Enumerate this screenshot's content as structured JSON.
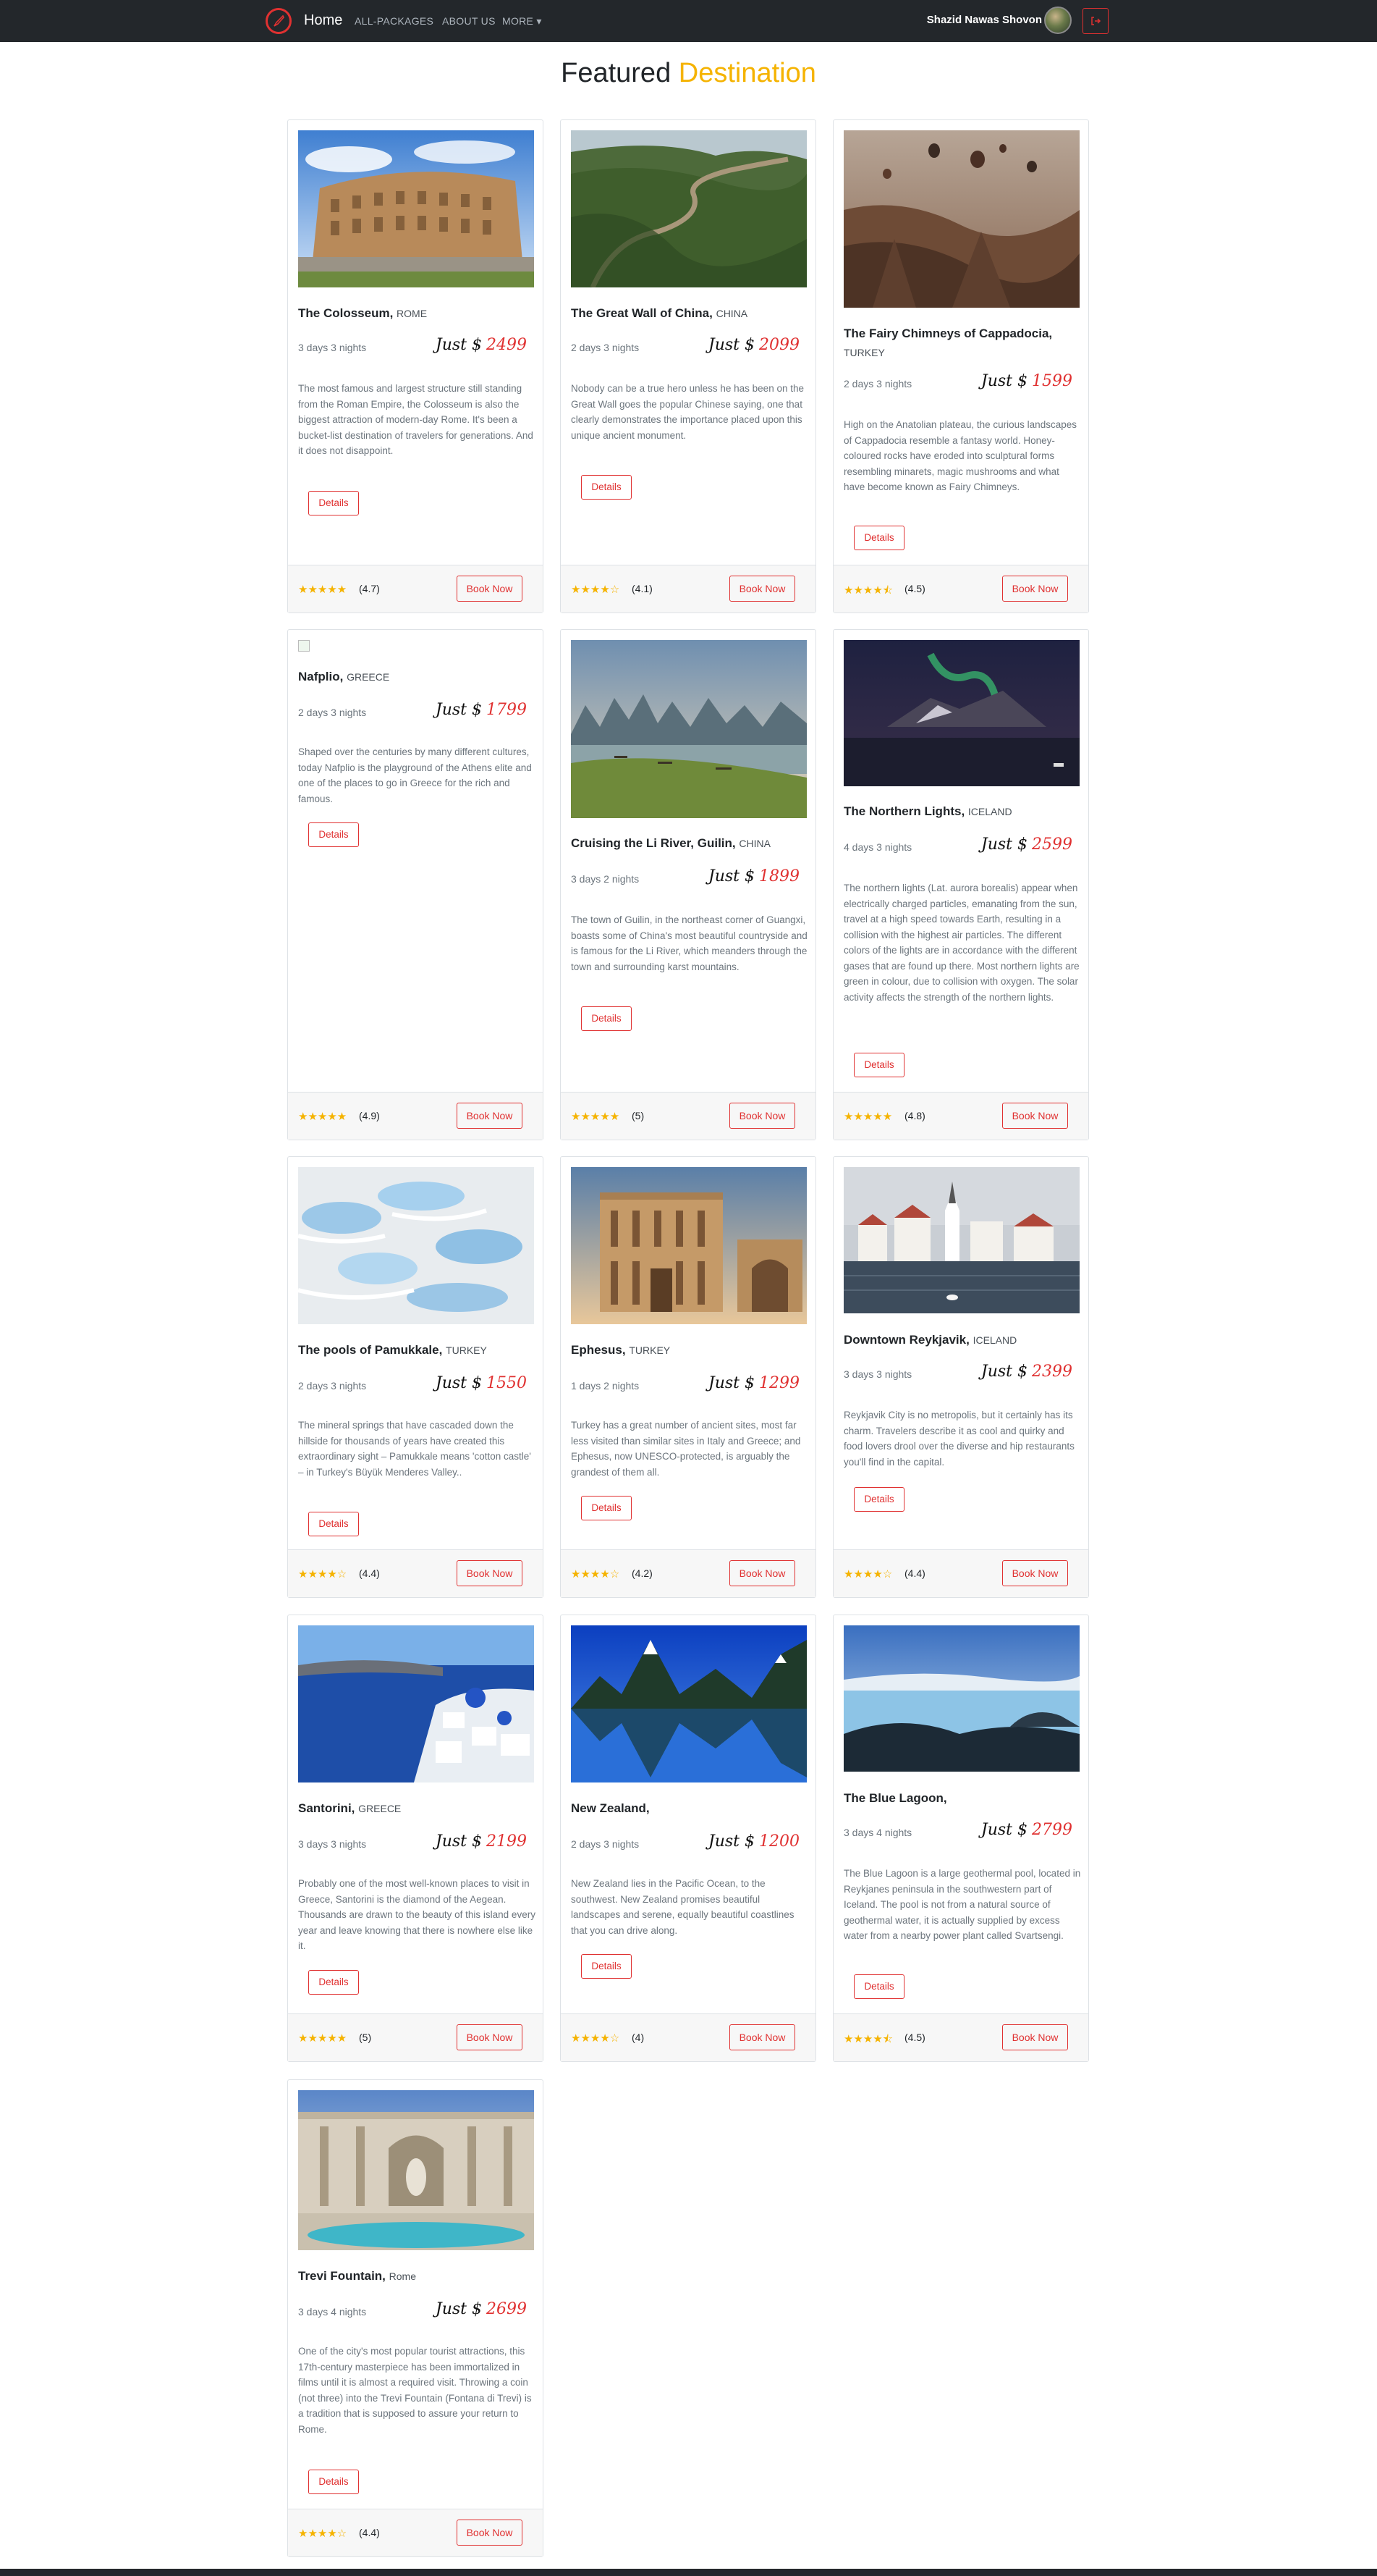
{
  "nav": {
    "home": "Home",
    "links": [
      "ALL-PACKAGES",
      "ABOUT US",
      "MORE ▾"
    ],
    "user_name": "Shazid Nawas Shovon"
  },
  "heading": {
    "main": "Featured",
    "accent": "Destination"
  },
  "labels": {
    "just": "Just",
    "currency": "$",
    "details": "Details",
    "book_now": "Book Now"
  },
  "colors": {
    "accent": "#f5b301",
    "brand_red": "#e03131",
    "navbar": "#23272b"
  },
  "cards": [
    {
      "name": "The Colosseum,",
      "location": "ROME",
      "duration": "3 days 3 nights",
      "price": "2499",
      "description": "The most famous and largest structure still standing from the Roman Empire, the Colosseum is also the biggest attraction of modern-day Rome. It's been a bucket-list destination of travelers for generations. And it does not disappoint.",
      "stars": "★★★★★",
      "rating": "(4.7)",
      "image": "colosseum"
    },
    {
      "name": "The Great Wall of China,",
      "location": "CHINA",
      "duration": "2 days 3 nights",
      "price": "2099",
      "description": "Nobody can be a true hero unless he has been on the Great Wall goes the popular Chinese saying, one that clearly demonstrates the importance placed upon this unique ancient monument.",
      "stars": "★★★★☆",
      "rating": "(4.1)",
      "image": "great-wall"
    },
    {
      "name": "The Fairy Chimneys of Cappadocia,",
      "location": "TURKEY",
      "duration": "2 days 3 nights",
      "price": "1599",
      "description": "High on the Anatolian plateau, the curious landscapes of Cappadocia resemble a fantasy world. Honey-coloured rocks have eroded into sculptural forms resembling minarets, magic mushrooms and what have become known as Fairy Chimneys.",
      "stars": "★★★★⯪",
      "rating": "(4.5)",
      "image": "cappadocia"
    },
    {
      "name": "Nafplio,",
      "location": "GREECE",
      "duration": "2 days 3 nights",
      "price": "1799",
      "description": "Shaped over the centuries by many different cultures, today Nafplio is the playground of the Athens elite and one of the places to go in Greece for the rich and famous.",
      "stars": "★★★★★",
      "rating": "(4.9)",
      "image": "broken"
    },
    {
      "name": "Cruising the Li River, Guilin,",
      "location": "CHINA",
      "duration": "3 days 2 nights",
      "price": "1899",
      "description": "The town of Guilin, in the northeast corner of Guangxi, boasts some of China's most beautiful countryside and is famous for the Li River, which meanders through the town and surrounding karst mountains.",
      "stars": "★★★★★",
      "rating": "(5)",
      "image": "li-river"
    },
    {
      "name": "The Northern Lights,",
      "location": "ICELAND",
      "duration": "4 days 3 nights",
      "price": "2599",
      "description": "The northern lights (Lat. aurora borealis) appear when electrically charged particles, emanating from the sun, travel at a high speed towards Earth, resulting in a collision with the highest air particles. The different colors of the lights are in accordance with the different gases that are found up there. Most northern lights are green in colour, due to collision with oxygen. The solar activity affects the strength of the northern lights.",
      "stars": "★★★★★",
      "rating": "(4.8)",
      "image": "aurora"
    },
    {
      "name": "The pools of Pamukkale,",
      "location": "TURKEY",
      "duration": "2 days 3 nights",
      "price": "1550",
      "description": "The mineral springs that have cascaded down the hillside for thousands of years have created this extraordinary sight – Pamukkale means 'cotton castle' – in Turkey's Büyük Menderes Valley..",
      "stars": "★★★★☆",
      "rating": "(4.4)",
      "image": "pamukkale"
    },
    {
      "name": "Ephesus,",
      "location": "TURKEY",
      "duration": "1 days 2 nights",
      "price": "1299",
      "description": "Turkey has a great number of ancient sites, most far less visited than similar sites in Italy and Greece; and Ephesus, now UNESCO-protected, is arguably the grandest of them all.",
      "stars": "★★★★☆",
      "rating": "(4.2)",
      "image": "ephesus"
    },
    {
      "name": "Downtown Reykjavik,",
      "location": "ICELAND",
      "duration": "3 days 3 nights",
      "price": "2399",
      "description": "Reykjavik City is no metropolis, but it certainly has its charm. Travelers describe it as cool and quirky and food lovers drool over the diverse and hip restaurants you'll find in the capital.",
      "stars": "★★★★☆",
      "rating": "(4.4)",
      "image": "reykjavik"
    },
    {
      "name": "Santorini,",
      "location": "GREECE",
      "duration": "3 days 3 nights",
      "price": "2199",
      "description": "Probably one of the most well-known places to visit in Greece, Santorini is the diamond of the Aegean. Thousands are drawn to the beauty of this island every year and leave knowing that there is nowhere else like it.",
      "stars": "★★★★★",
      "rating": "(5)",
      "image": "santorini"
    },
    {
      "name": "New Zealand,",
      "location": "",
      "duration": "2 days 3 nights",
      "price": "1200",
      "description": "New Zealand lies in the Pacific Ocean, to the southwest. New Zealand promises beautiful landscapes and serene, equally beautiful coastlines that you can drive along.",
      "stars": "★★★★☆",
      "rating": "(4)",
      "image": "new-zealand"
    },
    {
      "name": "The Blue Lagoon,",
      "location": "",
      "duration": "3 days 4 nights",
      "price": "2799",
      "description": "The Blue Lagoon is a large geothermal pool, located in Reykjanes peninsula in the southwestern part of Iceland. The pool is not from a natural source of geothermal water, it is actually supplied by excess water from a nearby power plant called Svartsengi.",
      "stars": "★★★★⯪",
      "rating": "(4.5)",
      "image": "blue-lagoon"
    },
    {
      "name": "Trevi Fountain,",
      "location": "Rome",
      "duration": "3 days 4 nights",
      "price": "2699",
      "description": "One of the city's most popular tourist attractions, this 17th-century masterpiece has been immortalized in films until it is almost a required visit. Throwing a coin (not three) into the Trevi Fountain (Fontana di Trevi) is a tradition that is supposed to assure your return to Rome.",
      "stars": "★★★★☆",
      "rating": "(4.4)",
      "image": "trevi"
    }
  ]
}
